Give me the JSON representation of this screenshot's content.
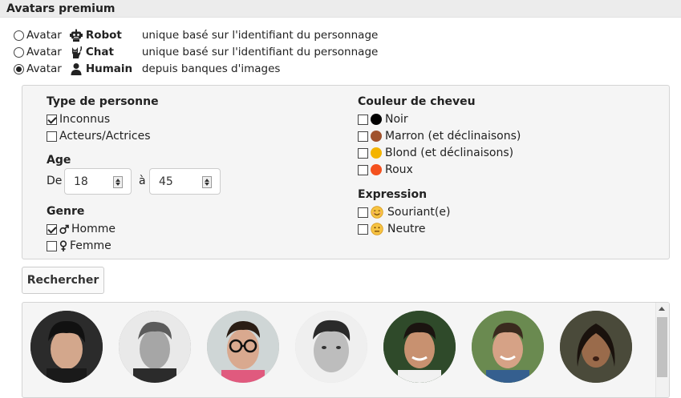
{
  "header": {
    "title": "Avatars premium"
  },
  "avatar_options": [
    {
      "prefix": "Avatar",
      "icon": "robot-icon",
      "name": "Robot",
      "desc": "unique basé sur l'identifiant du personnage",
      "checked": false
    },
    {
      "prefix": "Avatar",
      "icon": "cat-icon",
      "name": "Chat",
      "desc": "unique basé sur l'identifiant du personnage",
      "checked": false
    },
    {
      "prefix": "Avatar",
      "icon": "person-icon",
      "name": "Humain",
      "desc": "depuis banques d'images",
      "checked": true
    }
  ],
  "filters": {
    "person_type": {
      "title": "Type de personne",
      "options": [
        {
          "label": "Inconnus",
          "checked": true
        },
        {
          "label": "Acteurs/Actrices",
          "checked": false
        }
      ]
    },
    "age": {
      "title": "Age",
      "from_label": "De",
      "from_value": "18",
      "to_label": "à",
      "to_value": "45"
    },
    "gender": {
      "title": "Genre",
      "options": [
        {
          "label": "Homme",
          "icon": "male-icon",
          "checked": true
        },
        {
          "label": "Femme",
          "icon": "female-icon",
          "checked": false
        }
      ]
    },
    "hair": {
      "title": "Couleur de cheveu",
      "options": [
        {
          "label": "Noir",
          "color": "#000000",
          "checked": false
        },
        {
          "label": "Marron (et déclinaisons)",
          "color": "#a0522d",
          "checked": false
        },
        {
          "label": "Blond (et déclinaisons)",
          "color": "#f4b400",
          "checked": false
        },
        {
          "label": "Roux",
          "color": "#f4511e",
          "checked": false
        }
      ]
    },
    "expression": {
      "title": "Expression",
      "options": [
        {
          "label": "Souriant(e)",
          "icon": "smiling-face-icon",
          "checked": false
        },
        {
          "label": "Neutre",
          "icon": "neutral-face-icon",
          "checked": false
        }
      ]
    }
  },
  "search_button": {
    "label": "Rechercher"
  },
  "results": {
    "avatars": [
      {
        "name": "avatar-1",
        "bg": "#2b2b2b"
      },
      {
        "name": "avatar-2",
        "bg": "#8a8a8a"
      },
      {
        "name": "avatar-3",
        "bg": "#b0a9a4"
      },
      {
        "name": "avatar-4",
        "bg": "#d8d8d8"
      },
      {
        "name": "avatar-5",
        "bg": "#2f4a2a"
      },
      {
        "name": "avatar-6",
        "bg": "#6a8a50"
      },
      {
        "name": "avatar-7",
        "bg": "#4a4a3a"
      }
    ]
  }
}
